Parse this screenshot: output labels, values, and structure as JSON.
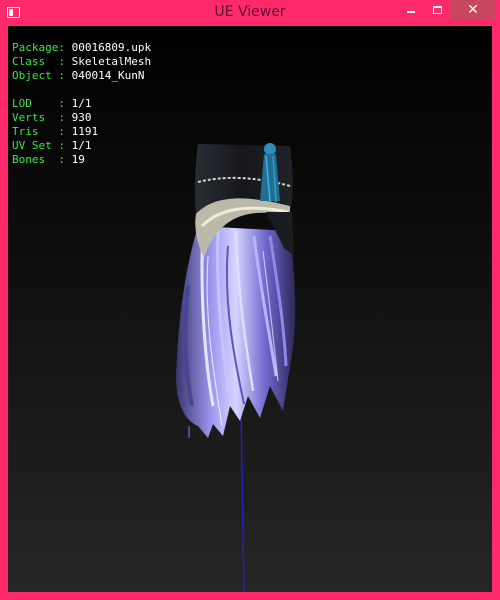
{
  "window": {
    "title": "UE Viewer",
    "accent_color": "#ff2a6a",
    "close_button_color": "#c9475e"
  },
  "titlebar_icons": {
    "app": "app-window-icon",
    "minimize": "minimize-icon",
    "maximize": "maximize-icon",
    "close": "close-icon",
    "close_glyph": "✕"
  },
  "info_panel": {
    "label_color": "#3ce63c",
    "value_color": "#ffffff",
    "object_info": [
      {
        "label": "Package: ",
        "value": "00016809.upk"
      },
      {
        "label": "Class  : ",
        "value": "SkeletalMesh"
      },
      {
        "label": "Object : ",
        "value": "040014_KunN"
      }
    ],
    "mesh_stats": [
      {
        "label": "LOD    : ",
        "value": "1/1"
      },
      {
        "label": "Verts  : ",
        "value": "930"
      },
      {
        "label": "Tris   : ",
        "value": "1191"
      },
      {
        "label": "UV Set : ",
        "value": "1/1"
      },
      {
        "label": "Bones  : ",
        "value": "19"
      }
    ]
  },
  "viewport": {
    "mesh_colors": {
      "hat": "#1d2026",
      "band": "#c9c6b8",
      "tassel": "#2b7fa6",
      "hair_light": "#c9c6ff",
      "hair_mid": "#7b76e0",
      "hair_dark": "#3a356e",
      "axis_line": "#2020c0"
    }
  }
}
